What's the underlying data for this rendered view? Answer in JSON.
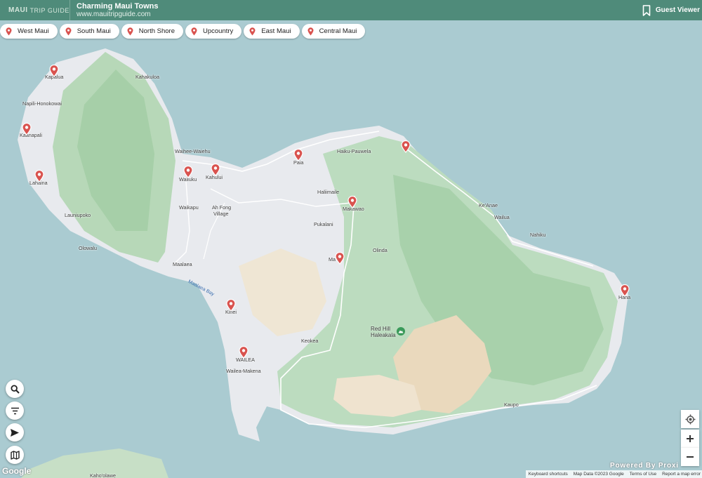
{
  "header": {
    "logo_main": "MAUI",
    "logo_sub": "TRIP GUIDE",
    "title": "Charming Maui Towns",
    "site": "www.mauitripguide.com",
    "viewer_label": "Guest Viewer"
  },
  "filters": [
    {
      "label": "West Maui"
    },
    {
      "label": "South Maui"
    },
    {
      "label": "North Shore"
    },
    {
      "label": "Upcountry"
    },
    {
      "label": "East Maui"
    },
    {
      "label": "Central Maui"
    }
  ],
  "map": {
    "bay_label": "Maalaea Bay",
    "peak_label_1": "Red Hill",
    "peak_label_2": "Haleakala",
    "places": [
      "Kapalua",
      "Kahakuloa",
      "Napili-Honokowai",
      "Kaanapali",
      "Lahaina",
      "Launiupoko",
      "Olowalu",
      "Waihee-Waiehu",
      "Wailuku",
      "Kahului",
      "Waikapu",
      "Ah Fong",
      "Village",
      "Maalaea",
      "Paia",
      "Haiku-Pauwela",
      "Haliimaile",
      "Makawao",
      "Pukalani",
      "Ma",
      "Olinda",
      "Ke'Anae",
      "Wailua",
      "Nahiku",
      "Hana",
      "Kihei",
      "WAILEA",
      "Wailea-Makena",
      "Keokea",
      "Kaupo",
      "Kaho'olawe"
    ],
    "pin_count": 12
  },
  "controls": {
    "google": "Google",
    "powered": "Powered By Proxi",
    "attrib_keyboard": "Keyboard shortcuts",
    "attrib_data": "Map Data ©2023 Google",
    "attrib_terms": "Terms of Use",
    "attrib_report": "Report a map error"
  },
  "colors": {
    "header": "#4f8b7a",
    "water": "#aacbd1",
    "land": "#e8eaee",
    "forest": "#b5d9b8",
    "pin": "#d9534f"
  }
}
